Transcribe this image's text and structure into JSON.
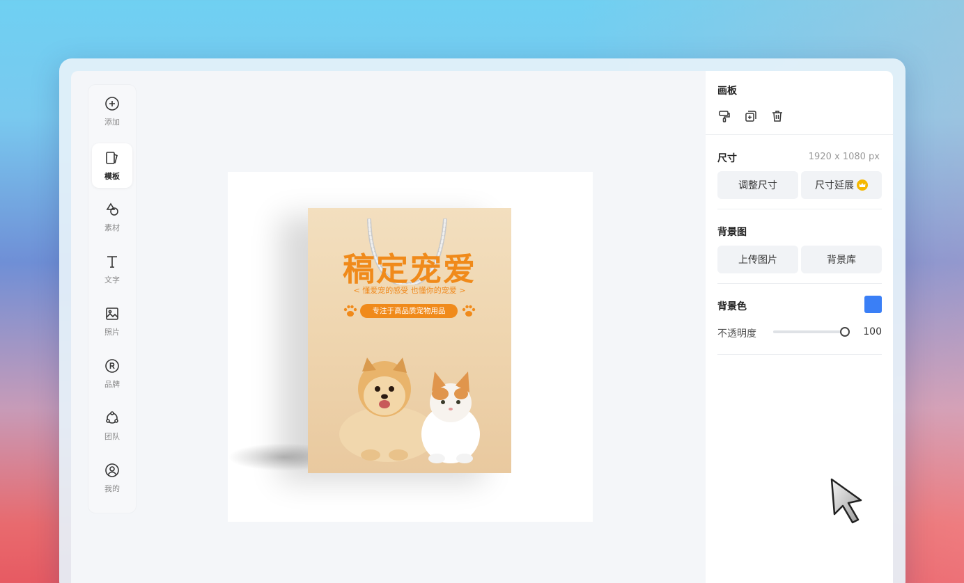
{
  "sidebar": {
    "items": [
      {
        "label": "添加",
        "icon": "plus-circle-icon"
      },
      {
        "label": "模板",
        "icon": "template-icon"
      },
      {
        "label": "素材",
        "icon": "shapes-icon"
      },
      {
        "label": "文字",
        "icon": "text-icon"
      },
      {
        "label": "照片",
        "icon": "image-icon"
      },
      {
        "label": "品牌",
        "icon": "registered-icon"
      },
      {
        "label": "团队",
        "icon": "team-icon"
      },
      {
        "label": "我的",
        "icon": "user-circle-icon"
      }
    ],
    "active": "模板"
  },
  "canvas": {
    "design": {
      "title": "稿定宠爱",
      "subtitle": "< 懂爱宠的感受 也懂你的宠爱 >",
      "tagline": "专注于高品质宠物用品"
    }
  },
  "panel": {
    "board_title": "画板",
    "board_icons": [
      "format-painter-icon",
      "duplicate-icon",
      "trash-icon"
    ],
    "size_label": "尺寸",
    "size_value": "1920 x 1080 px",
    "resize_button": "调整尺寸",
    "extend_button": "尺寸延展",
    "bg_image_label": "背景图",
    "upload_button": "上传图片",
    "library_button": "背景库",
    "bg_color_label": "背景色",
    "bg_color": "#3a7ff6",
    "opacity_label": "不透明度",
    "opacity_value": "100"
  },
  "colors": {
    "accent_orange": "#f08a1a",
    "crown": "#f5b800"
  }
}
